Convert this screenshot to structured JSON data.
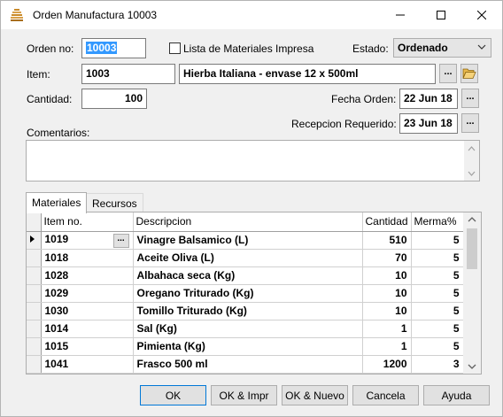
{
  "window": {
    "title": "Orden Manufactura 10003"
  },
  "form": {
    "orden_label": "Orden no:",
    "orden_value": "10003",
    "lista_label": "Lista de Materiales Impresa",
    "estado_label": "Estado:",
    "estado_value": "Ordenado",
    "item_label": "Item:",
    "item_code": "1003",
    "item_desc": "Hierba Italiana - envase 12 x 500ml",
    "cantidad_label": "Cantidad:",
    "cantidad_value": "100",
    "fecha_label": "Fecha Orden:",
    "fecha_value": "22 Jun 18",
    "recepcion_label": "Recepcion Requerido:",
    "recepcion_value": "23 Jun 18",
    "comentarios_label": "Comentarios:",
    "ellipsis": "..."
  },
  "tabs": [
    "Materiales",
    "Recursos"
  ],
  "grid": {
    "headers": [
      "Item no.",
      "Descripcion",
      "Cantidad",
      "Merma%"
    ],
    "rows": [
      [
        "1019",
        "Vinagre Balsamico (L)",
        "510",
        "5"
      ],
      [
        "1018",
        "Aceite Oliva (L)",
        "70",
        "5"
      ],
      [
        "1028",
        "Albahaca seca (Kg)",
        "10",
        "5"
      ],
      [
        "1029",
        "Oregano Triturado (Kg)",
        "10",
        "5"
      ],
      [
        "1030",
        "Tomillo Triturado (Kg)",
        "10",
        "5"
      ],
      [
        "1014",
        "Sal (Kg)",
        "1",
        "5"
      ],
      [
        "1015",
        "Pimienta (Kg)",
        "1",
        "5"
      ],
      [
        "1041",
        "Frasco 500 ml",
        "1200",
        "3"
      ]
    ]
  },
  "buttons": {
    "ok": "OK",
    "ok_impr": "OK & Impr",
    "ok_nuevo": "OK & Nuevo",
    "cancela": "Cancela",
    "ayuda": "Ayuda"
  }
}
